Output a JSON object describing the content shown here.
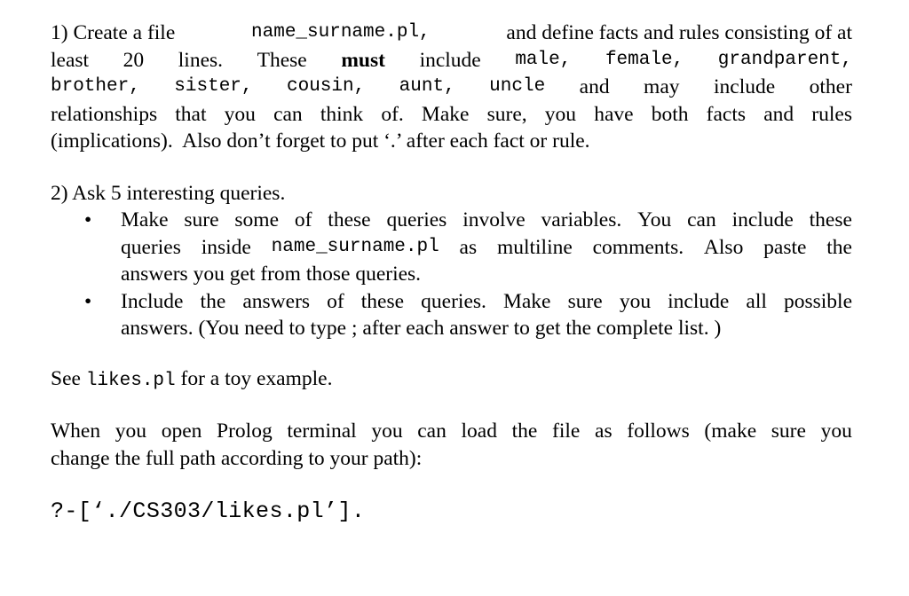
{
  "document": {
    "background_color": "#ffffff",
    "text_color": "#000000",
    "bullet_glyph": "•"
  },
  "item1": {
    "line1": {
      "a": "1) Create a file ",
      "code": "name_surname.pl,",
      "b": " and define facts and rules consisting of at"
    },
    "line2": {
      "a": "least",
      "b": "20",
      "c": "lines.",
      "d": "These",
      "bold": "must",
      "e": "include",
      "code1": "male,",
      "code2": "female,",
      "code3": "grandparent,"
    },
    "line3": {
      "code1": "brother,",
      "code2": "sister,",
      "code3": "cousin,",
      "code4": "aunt,",
      "code5": "uncle",
      "a": "and",
      "b": "may",
      "c": "include",
      "d": "other"
    },
    "line4": {
      "a": "relationships",
      "b": "that",
      "c": "you",
      "d": "can",
      "e": "think",
      "f": "of.",
      "g": "Make",
      "h": "sure,",
      "i": "you",
      "j": "have",
      "k": "both",
      "l": "facts",
      "m": "and",
      "n": "rules"
    },
    "line5": "(implications).  Also don’t forget to put ‘.’ after each fact or rule."
  },
  "item2": {
    "heading": "2) Ask 5 interesting queries.",
    "bullet1": {
      "line1": {
        "a": "Make",
        "b": "sure",
        "c": "some",
        "d": "of",
        "e": "these",
        "f": "queries",
        "g": "involve",
        "h": "variables.",
        "i": "You",
        "j": "can",
        "k": "include",
        "l": "these"
      },
      "line2": {
        "a": "queries",
        "b": "inside",
        "code": "name_surname.pl",
        "c": "as",
        "d": "multiline",
        "e": "comments.",
        "f": "Also",
        "g": "paste",
        "h": "the"
      },
      "line3": "answers you get from those queries."
    },
    "bullet2": {
      "line1": {
        "a": "Include",
        "b": "the",
        "c": "answers",
        "d": "of",
        "e": "these",
        "f": "queries.",
        "g": "Make",
        "h": "sure",
        "i": "you",
        "j": "include",
        "k": "all",
        "l": "possible"
      },
      "line2": "answers. (You need to type ; after each answer to get the complete list. )"
    }
  },
  "see_line": {
    "a": "See ",
    "code": "likes.pl",
    "b": " for a toy example."
  },
  "prolog_intro": {
    "line1": {
      "a": "When",
      "b": "you",
      "c": "open",
      "d": "Prolog",
      "e": "terminal",
      "f": "you",
      "g": "can",
      "h": "load",
      "i": "the",
      "j": "file",
      "k": "as",
      "l": "follows",
      "m": "(make",
      "n": "sure",
      "o": "you"
    },
    "line2": "change the full path according to your path):"
  },
  "prolog_command": "?-[‘./CS303/likes.pl’]."
}
